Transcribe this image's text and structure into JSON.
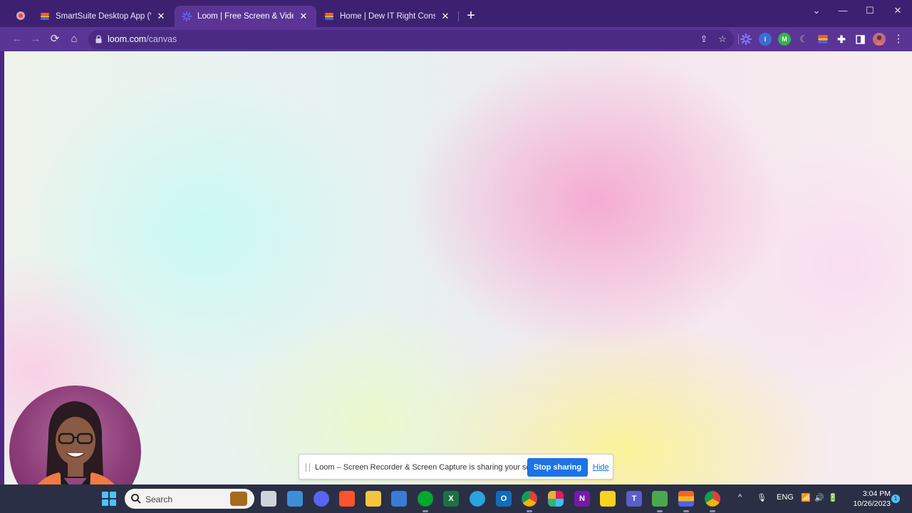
{
  "browser": {
    "tabs": [
      {
        "title": "SmartSuite Desktop App (Voten",
        "favicon": "smartsuite-icon",
        "active": false
      },
      {
        "title": "Loom | Free Screen & Video",
        "favicon": "loom-icon",
        "active": true
      },
      {
        "title": "Home | Dew IT Right Consulting",
        "favicon": "dewit-icon",
        "active": false
      }
    ],
    "close_glyph": "✕",
    "new_tab_glyph": "+",
    "window_controls": {
      "menu": "⌄",
      "minimize": "—",
      "maximize": "☐",
      "close": "✕"
    },
    "address": {
      "host": "loom.com",
      "path": "/canvas"
    },
    "nav": {
      "back": "←",
      "forward": "→",
      "reload": "⟳",
      "home": "⌂"
    },
    "omnibox_icons": {
      "share": "⇪",
      "bookmark": "☆"
    },
    "extensions": [
      {
        "name": "loom-extension-icon",
        "label": "",
        "color": "#625df5"
      },
      {
        "name": "info-extension-icon",
        "label": "i",
        "color": "#3a6fd8"
      },
      {
        "name": "m-extension-icon",
        "label": "M",
        "color": "#37b24d"
      },
      {
        "name": "moon-extension-icon",
        "label": "",
        "color": "#6b5a8e"
      },
      {
        "name": "smartsuite-extension-icon",
        "label": "",
        "color": "#f26522"
      },
      {
        "name": "puzzle-icon",
        "label": "",
        "color": "transparent"
      },
      {
        "name": "sidepanel-icon",
        "label": "",
        "color": "transparent"
      },
      {
        "name": "profile-avatar",
        "label": "",
        "color": "#b75a7e"
      }
    ],
    "menu_glyph": "⋮"
  },
  "share_banner": {
    "message": "Loom – Screen Recorder & Screen Capture is sharing your screen.",
    "stop_label": "Stop sharing",
    "hide_label": "Hide"
  },
  "taskbar": {
    "search_label": "Search",
    "apps": [
      {
        "name": "task-view-icon",
        "label": "",
        "color": "#cfd3dc"
      },
      {
        "name": "file-explorer-app-icon",
        "label": "",
        "color": "#3d8fd9"
      },
      {
        "name": "discord-app-icon",
        "label": "",
        "color": "#5865f2"
      },
      {
        "name": "brave-app-icon",
        "label": "",
        "color": "#fb542b"
      },
      {
        "name": "folder-app-icon",
        "label": "",
        "color": "#f5c542"
      },
      {
        "name": "calculator-app-icon",
        "label": "",
        "color": "#3a7bd5"
      },
      {
        "name": "evernote-app-icon",
        "label": "",
        "color": "#00a82d"
      },
      {
        "name": "excel-app-icon",
        "label": "X",
        "color": "#1d7044"
      },
      {
        "name": "telegram-app-icon",
        "label": "",
        "color": "#2aa3de"
      },
      {
        "name": "outlook-app-icon",
        "label": "O",
        "color": "#0f6cbd"
      },
      {
        "name": "chrome-app-icon",
        "label": "",
        "color": "#db4437"
      },
      {
        "name": "slack-app-icon",
        "label": "",
        "color": "#e01e5a"
      },
      {
        "name": "onenote-app-icon",
        "label": "N",
        "color": "#7719aa"
      },
      {
        "name": "sticky-notes-app-icon",
        "label": "",
        "color": "#f8d21c"
      },
      {
        "name": "teams-app-icon",
        "label": "T",
        "color": "#5b5fc7"
      },
      {
        "name": "snip-app-icon",
        "label": "",
        "color": "#4aa84e"
      },
      {
        "name": "smartsuite-app-icon",
        "label": "",
        "color": "#f26522"
      },
      {
        "name": "chrome-profile-app-icon",
        "label": "",
        "color": "#db4437"
      }
    ],
    "tray": {
      "chevron": "^",
      "mic": "🎙",
      "language": "ENG",
      "wifi": "📶",
      "volume": "🔊",
      "battery": "🔋"
    },
    "time": "3:04 PM",
    "date": "10/26/2023",
    "notification_count": "1"
  }
}
